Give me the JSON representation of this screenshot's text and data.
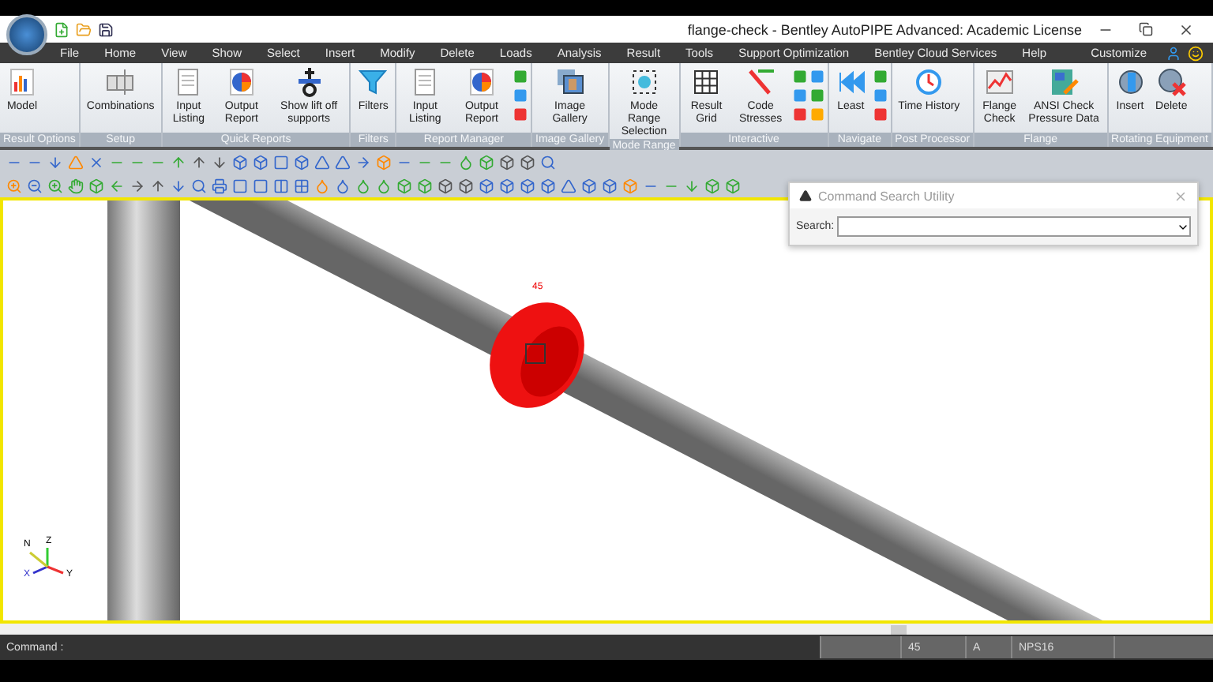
{
  "window": {
    "title": "flange-check - Bentley AutoPIPE Advanced: Academic License"
  },
  "menu": {
    "items": [
      {
        "label": "File"
      },
      {
        "label": "Home"
      },
      {
        "label": "View"
      },
      {
        "label": "Show"
      },
      {
        "label": "Select"
      },
      {
        "label": "Insert"
      },
      {
        "label": "Modify"
      },
      {
        "label": "Delete"
      },
      {
        "label": "Loads"
      },
      {
        "label": "Analysis"
      },
      {
        "label": "Result"
      },
      {
        "label": "Tools"
      },
      {
        "label": "Support Optimization"
      },
      {
        "label": "Bentley Cloud Services"
      },
      {
        "label": "Help"
      }
    ],
    "customize": "Customize"
  },
  "ribbon": {
    "groups": [
      {
        "label": "Result Options",
        "buttons": [
          {
            "label": "Model"
          }
        ]
      },
      {
        "label": "Setup",
        "buttons": [
          {
            "label": "Combinations"
          }
        ]
      },
      {
        "label": "Quick Reports",
        "buttons": [
          {
            "label": "Input Listing"
          },
          {
            "label": "Output Report"
          },
          {
            "label": "Show lift off supports"
          }
        ]
      },
      {
        "label": "Filters",
        "buttons": [
          {
            "label": "Filters"
          }
        ]
      },
      {
        "label": "Report Manager",
        "buttons": [
          {
            "label": "Input Listing"
          },
          {
            "label": "Output Report"
          }
        ]
      },
      {
        "label": "Image Gallery",
        "buttons": [
          {
            "label": "Image Gallery"
          }
        ]
      },
      {
        "label": "Mode Range",
        "buttons": [
          {
            "label": "Mode Range Selection"
          }
        ]
      },
      {
        "label": "Interactive",
        "buttons": [
          {
            "label": "Result Grid"
          },
          {
            "label": "Code Stresses"
          }
        ]
      },
      {
        "label": "Navigate",
        "buttons": [
          {
            "label": "Least"
          }
        ]
      },
      {
        "label": "Post Processor",
        "buttons": [
          {
            "label": "Time History"
          }
        ]
      },
      {
        "label": "Flange",
        "buttons": [
          {
            "label": "Flange Check"
          },
          {
            "label": "ANSI Check Pressure Data"
          }
        ]
      },
      {
        "label": "Rotating Equipment",
        "buttons": [
          {
            "label": "Insert"
          },
          {
            "label": "Delete"
          }
        ]
      }
    ]
  },
  "viewport": {
    "flange_label": "45",
    "axes": [
      "N",
      "Z",
      "X",
      "Y"
    ]
  },
  "command_search": {
    "title": "Command Search Utility",
    "search_label": "Search:"
  },
  "status_bar": {
    "command_label": "Command :",
    "cells": [
      "",
      "45",
      "A",
      "NPS16",
      ""
    ]
  }
}
